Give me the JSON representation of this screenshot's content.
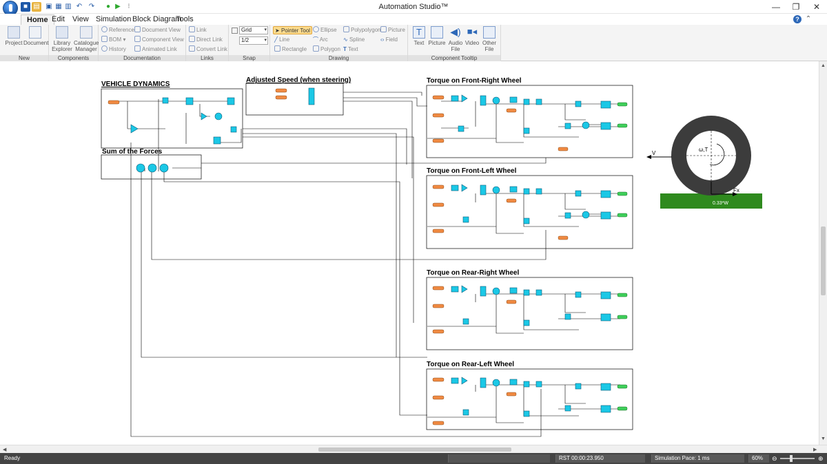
{
  "window": {
    "title": "Automation Studio™",
    "minimize": "—",
    "restore": "❐",
    "close": "✕"
  },
  "menu": {
    "tabs": [
      "Home",
      "Edit",
      "View",
      "Simulation",
      "Block Diagram",
      "Tools"
    ],
    "active": "Home",
    "help": "?"
  },
  "ribbon": {
    "new_group": {
      "label": "New",
      "project": "Project",
      "document": "Document"
    },
    "components_group": {
      "label": "Components",
      "library_explorer": "Library Explorer",
      "catalogue_manager": "Catalogue Manager"
    },
    "documentation_group": {
      "label": "Documentation",
      "reference": "Reference",
      "document_view": "Document View",
      "bom": "BOM",
      "component_view": "Component View",
      "history": "History",
      "animated_link": "Animated Link"
    },
    "links_group": {
      "label": "Links",
      "link": "Link",
      "direct_link": "Direct Link",
      "convert_link": "Convert Link"
    },
    "snap_group": {
      "label": "Snap",
      "grid_value": "Grid",
      "grid_size": "1/2"
    },
    "drawing_group": {
      "label": "Drawing",
      "pointer_tool": "Pointer Tool",
      "ellipse": "Ellipse",
      "polypolygon": "Polypolygon",
      "picture": "Picture",
      "line": "Line",
      "arc": "Arc",
      "spline": "Spline",
      "field": "Field",
      "rectangle": "Rectangle",
      "polygon": "Polygon",
      "text": "Text"
    },
    "tooltip_group": {
      "label": "Component Tooltip",
      "text": "Text",
      "picture": "Picture",
      "audio_file": "Audio File",
      "video": "Video",
      "other_file": "Other File"
    }
  },
  "diagram": {
    "titles": {
      "vehicle_dynamics": "VEHICLE DYNAMICS",
      "adjusted_speed": "Adjusted Speed (when steering)",
      "sum_of_forces": "Sum of the Forces",
      "torque_fr": "Torque on Front-Right Wheel",
      "torque_fl": "Torque on Front-Left Wheel",
      "torque_rr": "Torque on Rear-Right Wheel",
      "torque_rl": "Torque on Rear-Left Wheel"
    },
    "wheel_labels": {
      "v": "V",
      "w_t": "ω,T",
      "fx": "Fx",
      "weight": "0.33*W"
    }
  },
  "status": {
    "ready": "Ready",
    "time": "RST 00:00:23.950",
    "pace": "Simulation Pace: 1 ms",
    "zoom": "60%"
  }
}
